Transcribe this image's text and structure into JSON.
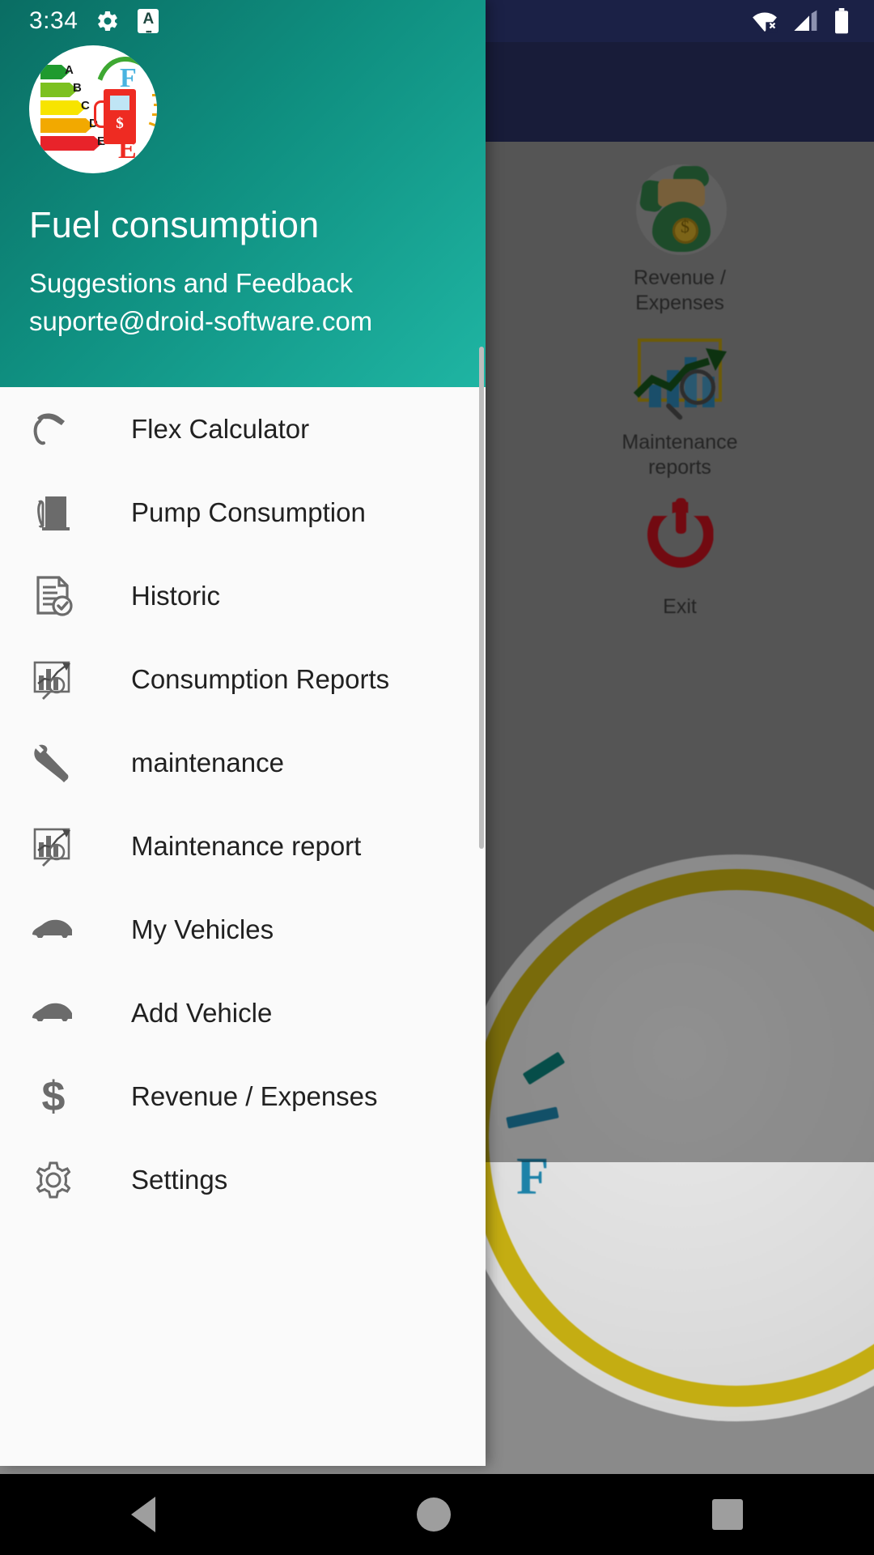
{
  "status_bar": {
    "clock": "3:34",
    "left_icons": [
      "gear-icon",
      "app-notification-badge"
    ],
    "badge_letter": "A",
    "right_icons": [
      "wifi-off-icon",
      "cellular-signal-icon",
      "battery-full-icon"
    ]
  },
  "drawer": {
    "logo": {
      "name": "fuel-consumption-logo",
      "energy_labels": [
        "A",
        "B",
        "C",
        "D",
        "E"
      ],
      "energy_colors": [
        "#1f9a2e",
        "#7cc120",
        "#f7e400",
        "#f2a900",
        "#e8232a"
      ],
      "gauge_full_label": "F",
      "gauge_empty_label": "E",
      "pump_symbol": "$"
    },
    "title": "Fuel consumption",
    "subtitle_line1": "Suggestions and Feedback",
    "subtitle_line2": "suporte@droid-software.com",
    "header_gradient_from": "#0a6d63",
    "header_gradient_to": "#1fb5a3",
    "items": [
      {
        "label": "Flex Calculator",
        "icon": "fuel-nozzle-icon"
      },
      {
        "label": "Pump Consumption",
        "icon": "fuel-pump-icon"
      },
      {
        "label": "Historic",
        "icon": "document-check-icon"
      },
      {
        "label": "Consumption Reports",
        "icon": "chart-report-icon"
      },
      {
        "label": "maintenance",
        "icon": "wrench-icon"
      },
      {
        "label": "Maintenance report",
        "icon": "chart-report-icon"
      },
      {
        "label": "My Vehicles",
        "icon": "car-icon"
      },
      {
        "label": "Add Vehicle",
        "icon": "car-icon"
      },
      {
        "label": "Revenue / Expenses",
        "icon": "dollar-icon"
      },
      {
        "label": "Settings",
        "icon": "gear-icon"
      }
    ]
  },
  "background_app": {
    "tiles": [
      {
        "label": "Revenue / Expenses",
        "icon": "money-bag-icon"
      },
      {
        "label": "Maintenance reports",
        "icon": "chart-magnifier-icon"
      },
      {
        "label": "Exit",
        "icon": "power-icon"
      }
    ],
    "gauge_full_label": "F"
  },
  "navbar": {
    "back": "back-triangle",
    "home": "home-circle",
    "recents": "recents-square"
  }
}
